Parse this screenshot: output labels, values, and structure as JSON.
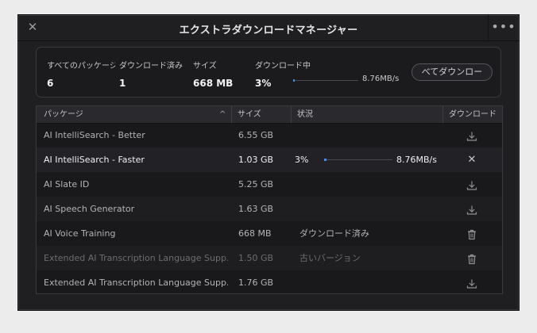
{
  "window": {
    "title": "エクストラダウンロードマネージャー",
    "close_glyph": "✕",
    "more_glyph": "•••"
  },
  "summary": {
    "all_packages_label": "すべてのパッケージ",
    "all_packages_value": "6",
    "downloaded_label": "ダウンロード済み",
    "downloaded_value": "1",
    "size_label": "サイズ",
    "size_value": "668 MB",
    "downloading_label": "ダウンロード中",
    "downloading_value": "3%",
    "progress_fraction": 0.03,
    "speed": "8.76MB/s",
    "download_all_label": "べてダウンロー"
  },
  "table": {
    "headers": {
      "package": "パッケージ",
      "size": "サイズ",
      "status": "状況",
      "download": "ダウンロード"
    },
    "sort_caret": "^",
    "rows": [
      {
        "name": "AI IntelliSearch - Better",
        "size": "6.55 GB",
        "status": "",
        "action": "download-icon"
      },
      {
        "name": "AI IntelliSearch - Faster",
        "size": "1.03 GB",
        "status": "3%",
        "progress_fraction": 0.03,
        "speed": "8.76MB/s",
        "action": "cancel-icon",
        "action_glyph": "✕"
      },
      {
        "name": "AI Slate ID",
        "size": "5.25 GB",
        "status": "",
        "action": "download-icon"
      },
      {
        "name": "AI Speech Generator",
        "size": "1.63 GB",
        "status": "",
        "action": "download-icon"
      },
      {
        "name": "AI Voice Training",
        "size": "668 MB",
        "status": "ダウンロード済み",
        "action": "trash-icon"
      },
      {
        "name": "Extended AI Transcription Language Supp...",
        "size": "1.50 GB",
        "status": "古いバージョン",
        "action": "trash-icon"
      },
      {
        "name": "Extended AI Transcription Language Supp...",
        "size": "1.76 GB",
        "status": "",
        "action": "download-icon"
      }
    ]
  },
  "colors": {
    "accent": "#3e8dff",
    "background": "#1f1f22"
  }
}
